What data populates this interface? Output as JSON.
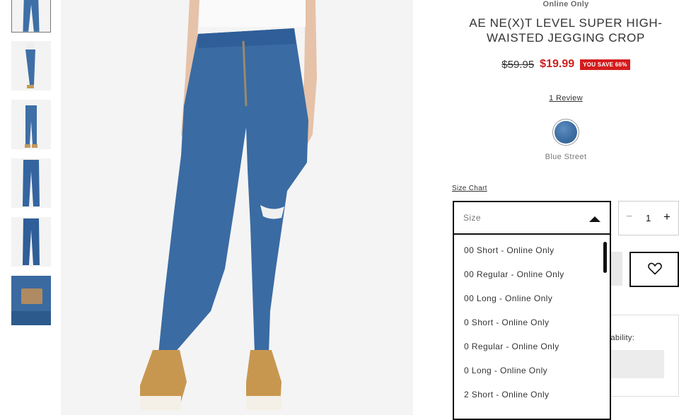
{
  "product": {
    "badge": "Online Only",
    "title": "AE NE(X)T LEVEL SUPER HIGH-WAISTED JEGGING CROP",
    "original_price": "$59.95",
    "sale_price": "$19.99",
    "savings": "YOU SAVE 66%",
    "reviews": "1 Review",
    "color_name": "Blue Street"
  },
  "size": {
    "chart_link": "Size Chart",
    "placeholder": "Size",
    "options": [
      "00 Short - Online Only",
      "00 Regular - Online Only",
      "00 Long - Online Only",
      "0 Short - Online Only",
      "0 Regular - Online Only",
      "0 Long - Online Only",
      "2 Short - Online Only"
    ]
  },
  "quantity": {
    "minus": "−",
    "value": "1",
    "plus": "+"
  },
  "store": {
    "availability_label": "ilability:"
  },
  "colors": {
    "sale": "#cc1f1f",
    "badge": "#d41c1c",
    "denim": "#3d6ea3"
  }
}
